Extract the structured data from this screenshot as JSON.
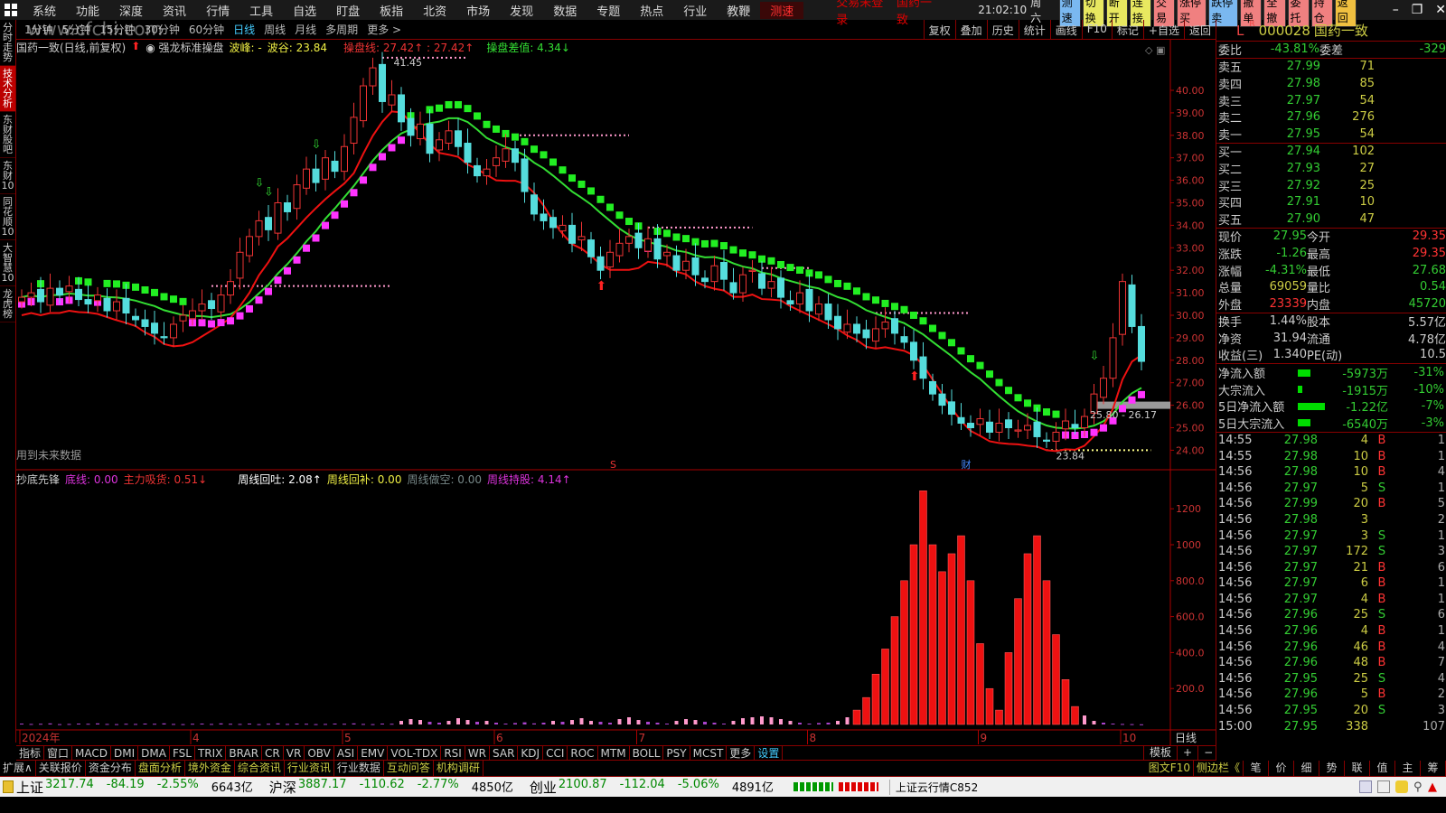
{
  "menu": {
    "items": [
      "系统",
      "功能",
      "深度",
      "资讯",
      "行情",
      "工具",
      "自选",
      "盯盘",
      "板指",
      "北资",
      "市场",
      "发现",
      "数据",
      "专题",
      "热点",
      "行业",
      "教鞭"
    ],
    "speed": "测速",
    "login_status": "交易未登录",
    "stock_name": "国药一致",
    "clock": "21:02:10",
    "weekday": "周六",
    "buttons": [
      {
        "label": "测速",
        "color": "#7ab8f0"
      },
      {
        "label": "切换",
        "color": "#e8e860"
      },
      {
        "label": "断开",
        "color": "#e8e860"
      },
      {
        "label": "连接",
        "color": "#e8e860"
      },
      {
        "label": "交易",
        "color": "#f08080"
      },
      {
        "label": "涨停买",
        "color": "#f08080"
      },
      {
        "label": "跌停卖",
        "color": "#7ab8f0"
      },
      {
        "label": "撤单",
        "color": "#f08080"
      },
      {
        "label": "全撤",
        "color": "#f08080"
      },
      {
        "label": "委托",
        "color": "#f08080"
      },
      {
        "label": "持仓",
        "color": "#f08080"
      },
      {
        "label": "返回",
        "color": "#f0c040"
      }
    ]
  },
  "left_tabs": [
    "分时走势",
    "技术分析",
    "东财股吧",
    "东财10",
    "同花顺10",
    "大智慧10",
    "龙虎榜"
  ],
  "watermark": "www.cfchi.com",
  "periods": [
    "1分钟",
    "5分钟",
    "15分钟",
    "30分钟",
    "60分钟",
    "日线",
    "周线",
    "月线",
    "多周期",
    "更多 >"
  ],
  "tools": [
    "复权",
    "叠加",
    "历史",
    "统计",
    "画线",
    "F10",
    "标记",
    "+自选",
    "返回"
  ],
  "chart_header": {
    "title": "国药一致(日线,前复权)",
    "indicator": "强龙标准操盘",
    "peak": "波峰: -",
    "trough": "波谷: 23.84",
    "line": "操盘线: 27.42↑ : 27.42↑",
    "diff": "操盘差值: 4.34↓"
  },
  "future_note": "用到未来数据",
  "ind_header": {
    "name": "抄底先锋",
    "bottom": "底线: 0.00",
    "main": "主力吸货: 0.51↓",
    "w1": "周线回吐: 2.08↑",
    "w2": "周线回补: 0.00",
    "w3": "周线做空: 0.00",
    "w4": "周线持股: 4.14↑"
  },
  "chart_data": {
    "type": "candlestick",
    "ylim": [
      24,
      40
    ],
    "yticks": [
      "40.00",
      "39.00",
      "38.00",
      "37.00",
      "36.00",
      "35.00",
      "34.00",
      "33.00",
      "32.00",
      "31.00",
      "30.00",
      "29.00",
      "28.00",
      "27.00",
      "26.00",
      "25.00",
      "24.00"
    ],
    "closes": [
      30.8,
      31.0,
      30.6,
      31.2,
      30.9,
      31.3,
      30.7,
      30.5,
      30.9,
      30.2,
      30.6,
      30.1,
      29.8,
      29.5,
      29.2,
      29.0,
      29.6,
      30.0,
      30.2,
      30.5,
      30.3,
      30.9,
      31.5,
      32.8,
      33.5,
      34.2,
      33.8,
      35.0,
      34.6,
      35.8,
      36.5,
      35.9,
      37.0,
      36.4,
      37.5,
      38.8,
      40.2,
      41.0,
      39.5,
      39.8,
      38.6,
      38.0,
      38.5,
      37.2,
      37.8,
      38.2,
      37.5,
      36.8,
      36.2,
      36.5,
      37.0,
      37.4,
      36.8,
      35.5,
      34.5,
      34.2,
      33.9,
      34.0,
      33.2,
      33.5,
      32.6,
      32.0,
      32.8,
      33.2,
      33.5,
      33.0,
      33.4,
      32.5,
      32.8,
      32.0,
      32.4,
      31.8,
      31.5,
      32.2,
      31.6,
      31.0,
      31.8,
      32.0,
      31.2,
      31.5,
      30.8,
      30.5,
      31.0,
      30.2,
      30.5,
      29.8,
      29.4,
      29.6,
      29.2,
      29.0,
      29.4,
      29.7,
      29.2,
      28.8,
      28.0,
      27.2,
      26.5,
      26.0,
      25.6,
      25.2,
      25.0,
      25.4,
      24.8,
      25.2,
      25.0,
      24.9,
      25.1,
      24.6,
      24.4,
      24.8,
      25.3,
      25.0,
      25.5,
      26.5,
      27.2,
      29.0,
      31.5,
      29.5,
      27.95
    ],
    "annotations": [
      "41.45",
      "23.84",
      "25.80 - 26.17"
    ],
    "levels": [
      {
        "price": 41.45,
        "from": 38,
        "to": 47
      },
      {
        "price": 31.3,
        "from": 20,
        "to": 39
      },
      {
        "price": 38.0,
        "from": 52,
        "to": 64
      },
      {
        "price": 33.9,
        "from": 66,
        "to": 77
      },
      {
        "price": 32.1,
        "from": 78,
        "to": 83
      },
      {
        "price": 30.1,
        "from": 90,
        "to": 100
      },
      {
        "price": 24.0,
        "from": 108,
        "to": 119
      }
    ],
    "zone": {
      "price": 26.0,
      "from": 113,
      "to": 121
    },
    "buy_signals": [
      25,
      26,
      31,
      37,
      113
    ],
    "sell_signals": [
      61,
      94
    ],
    "markers": [
      {
        "label": "S",
        "bar": 62
      },
      {
        "label": "财",
        "bar": 99
      }
    ],
    "month_labels": [
      {
        "label": "2024年",
        "bar": 0
      },
      {
        "label": "4",
        "bar": 18
      },
      {
        "label": "5",
        "bar": 34
      },
      {
        "label": "6",
        "bar": 50
      },
      {
        "label": "7",
        "bar": 65
      },
      {
        "label": "8",
        "bar": 83
      },
      {
        "label": "9",
        "bar": 101
      },
      {
        "label": "10",
        "bar": 116
      }
    ],
    "period_label": "日线",
    "indicator": {
      "ylim": [
        0,
        1300
      ],
      "yticks": [
        "1200",
        "1000",
        "800.0",
        "600.0",
        "400.0",
        "200.0"
      ],
      "values": [
        5,
        3,
        4,
        6,
        2,
        3,
        5,
        4,
        6,
        3,
        2,
        4,
        3,
        5,
        4,
        6,
        3,
        2,
        4,
        5,
        3,
        6,
        4,
        3,
        5,
        2,
        4,
        6,
        3,
        5,
        4,
        2,
        3,
        5,
        4,
        6,
        3,
        2,
        5,
        4,
        20,
        30,
        25,
        15,
        10,
        20,
        35,
        25,
        15,
        20,
        10,
        5,
        8,
        12,
        6,
        10,
        20,
        15,
        25,
        35,
        20,
        15,
        10,
        30,
        40,
        25,
        15,
        10,
        5,
        20,
        30,
        25,
        15,
        10,
        5,
        20,
        35,
        40,
        45,
        40,
        30,
        20,
        10,
        5,
        8,
        10,
        20,
        40,
        80,
        150,
        280,
        420,
        600,
        800,
        1000,
        1300,
        1000,
        850,
        950,
        1050,
        800,
        450,
        200,
        80,
        400,
        700,
        950,
        1050,
        800,
        500,
        250,
        100,
        50,
        20,
        10,
        5,
        3,
        2,
        1
      ]
    }
  },
  "order_book": {
    "code": "000028",
    "name": "国药一致",
    "wb_label": "委比",
    "wb": "-43.81%",
    "wc_label": "委差",
    "wc": "-329",
    "sells": [
      {
        "l": "卖五",
        "p": "27.99",
        "v": "71"
      },
      {
        "l": "卖四",
        "p": "27.98",
        "v": "85"
      },
      {
        "l": "卖三",
        "p": "27.97",
        "v": "54"
      },
      {
        "l": "卖二",
        "p": "27.96",
        "v": "276"
      },
      {
        "l": "卖一",
        "p": "27.95",
        "v": "54"
      }
    ],
    "buys": [
      {
        "l": "买一",
        "p": "27.94",
        "v": "102"
      },
      {
        "l": "买二",
        "p": "27.93",
        "v": "27"
      },
      {
        "l": "买三",
        "p": "27.92",
        "v": "25"
      },
      {
        "l": "买四",
        "p": "27.91",
        "v": "10"
      },
      {
        "l": "买五",
        "p": "27.90",
        "v": "47"
      }
    ]
  },
  "quote": [
    {
      "a": "现价",
      "b": "27.95",
      "bc": "g",
      "c": "今开",
      "d": "29.35",
      "dc": "r"
    },
    {
      "a": "涨跌",
      "b": "-1.26",
      "bc": "g",
      "c": "最高",
      "d": "29.35",
      "dc": "r"
    },
    {
      "a": "涨幅",
      "b": "-4.31%",
      "bc": "g",
      "c": "最低",
      "d": "27.68",
      "dc": "g"
    },
    {
      "a": "总量",
      "b": "69059",
      "bc": "y",
      "c": "量比",
      "d": "0.54",
      "dc": "g"
    },
    {
      "a": "外盘",
      "b": "23339",
      "bc": "r",
      "c": "内盘",
      "d": "45720",
      "dc": "g"
    }
  ],
  "fundamentals": [
    {
      "a": "换手",
      "b": "1.44%",
      "c": "股本",
      "d": "5.57亿"
    },
    {
      "a": "净资",
      "b": "31.94",
      "c": "流通",
      "d": "4.78亿"
    },
    {
      "a": "收益(三)",
      "b": "1.340",
      "c": "PE(动)",
      "d": "10.5"
    }
  ],
  "flows": [
    {
      "a": "净流入额",
      "bar": 0.35,
      "b": "-5973万",
      "c": "-31%"
    },
    {
      "a": "大宗流入",
      "bar": 0.12,
      "b": "-1915万",
      "c": "-10%"
    },
    {
      "a": "5日净流入额",
      "bar": 0.75,
      "b": "-1.22亿",
      "c": "-7%"
    },
    {
      "a": "5日大宗流入",
      "bar": 0.35,
      "b": "-6540万",
      "c": "-3%"
    }
  ],
  "ticks": [
    [
      "14:55",
      "27.98",
      "4",
      "B",
      "1"
    ],
    [
      "14:55",
      "27.98",
      "10",
      "B",
      "1"
    ],
    [
      "14:56",
      "27.98",
      "10",
      "B",
      "4"
    ],
    [
      "14:56",
      "27.97",
      "5",
      "S",
      "1"
    ],
    [
      "14:56",
      "27.99",
      "20",
      "B",
      "5"
    ],
    [
      "14:56",
      "27.98",
      "3",
      "",
      "2"
    ],
    [
      "14:56",
      "27.97",
      "3",
      "S",
      "1"
    ],
    [
      "14:56",
      "27.97",
      "172",
      "S",
      "3"
    ],
    [
      "14:56",
      "27.97",
      "21",
      "B",
      "6"
    ],
    [
      "14:56",
      "27.97",
      "6",
      "B",
      "1"
    ],
    [
      "14:56",
      "27.97",
      "4",
      "B",
      "1"
    ],
    [
      "14:56",
      "27.96",
      "25",
      "S",
      "6"
    ],
    [
      "14:56",
      "27.96",
      "4",
      "B",
      "1"
    ],
    [
      "14:56",
      "27.96",
      "46",
      "B",
      "4"
    ],
    [
      "14:56",
      "27.96",
      "48",
      "B",
      "7"
    ],
    [
      "14:56",
      "27.95",
      "25",
      "S",
      "4"
    ],
    [
      "14:56",
      "27.96",
      "5",
      "B",
      "2"
    ],
    [
      "14:56",
      "27.95",
      "20",
      "S",
      "3"
    ],
    [
      "15:00",
      "27.95",
      "338",
      "",
      "107"
    ]
  ],
  "indicators": [
    "指标",
    "窗口",
    "MACD",
    "DMI",
    "DMA",
    "FSL",
    "TRIX",
    "BRAR",
    "CR",
    "VR",
    "OBV",
    "ASI",
    "EMV",
    "VOL-TDX",
    "RSI",
    "WR",
    "SAR",
    "KDJ",
    "CCI",
    "ROC",
    "MTM",
    "BOLL",
    "PSY",
    "MCST",
    "更多",
    "设置"
  ],
  "template_btns": [
    "模板",
    "+",
    "−"
  ],
  "ext": [
    "扩展∧",
    "关联报价",
    "资金分布",
    "盘面分析",
    "境外资金",
    "综合资讯",
    "行业资讯",
    "行业数据",
    "互动问答",
    "机构调研"
  ],
  "side_btns": [
    "图文F10",
    "侧边栏《",
    "笔",
    "价",
    "细",
    "势",
    "联",
    "值",
    "主",
    "筹"
  ],
  "status": [
    {
      "name": "上证",
      "v": "3217.74",
      "c": "-84.19",
      "p": "-2.55%",
      "a": "6643亿"
    },
    {
      "name": "沪深",
      "v": "3887.17",
      "c": "-110.62",
      "p": "-2.77%",
      "a": "4850亿"
    },
    {
      "name": "创业",
      "v": "2100.87",
      "c": "-112.04",
      "p": "-5.06%",
      "a": "4891亿"
    }
  ],
  "server": "上证云行情C852"
}
